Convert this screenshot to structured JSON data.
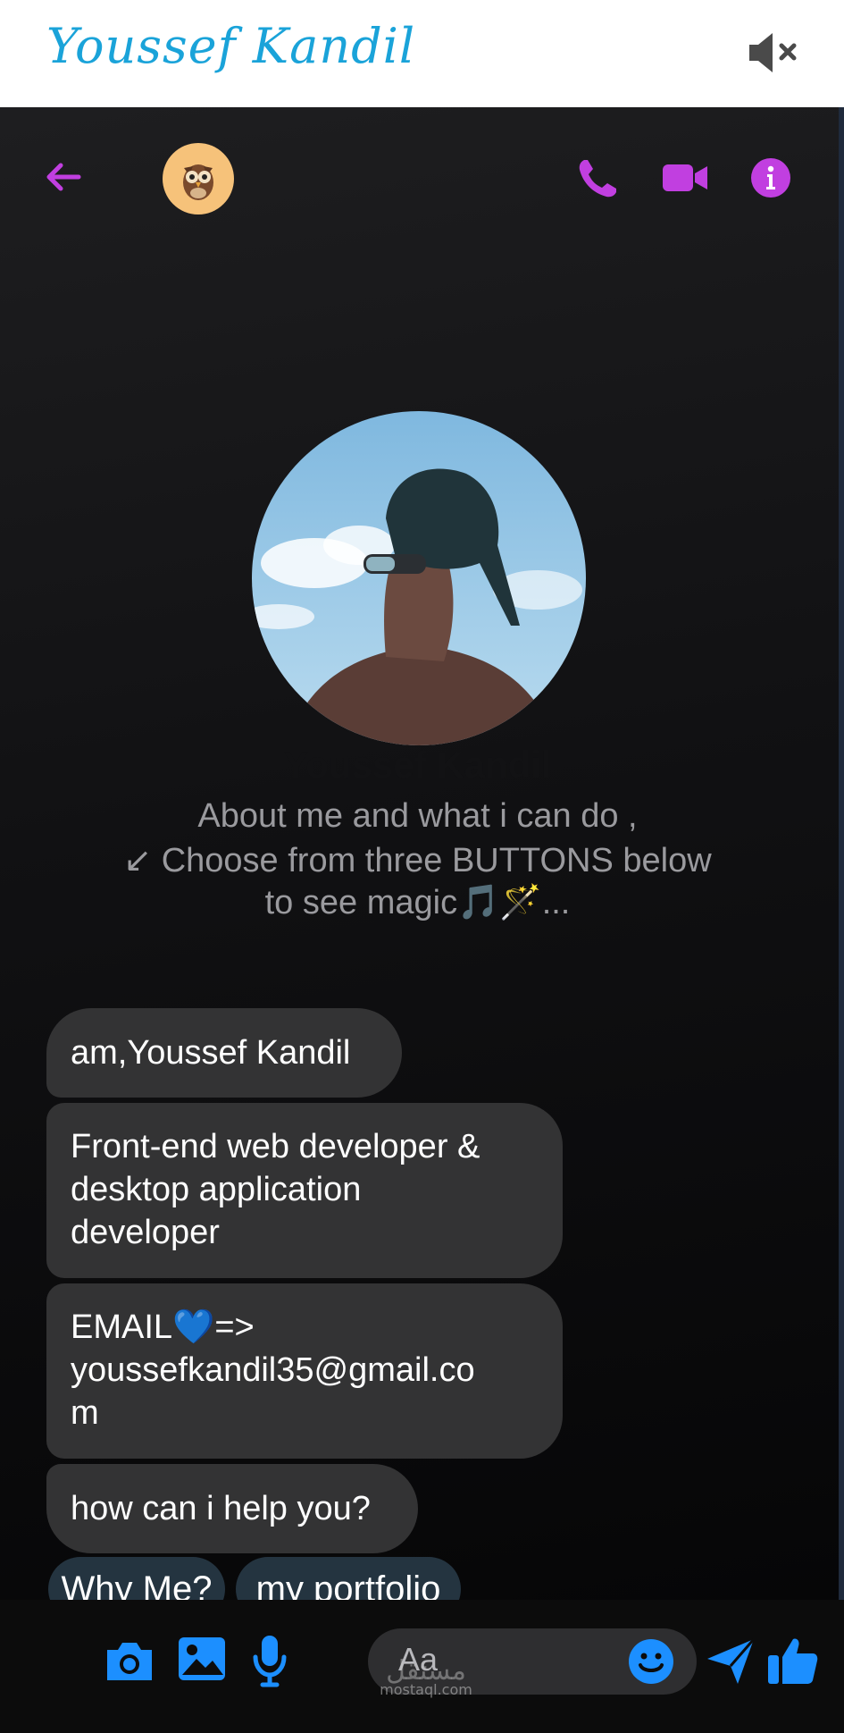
{
  "header": {
    "brand": "Youssef Kandil",
    "mute_icon": "speaker-muted-icon"
  },
  "toolbar": {
    "back_icon": "arrow-left-icon",
    "avatar": "owl-avatar",
    "call_icon": "phone-icon",
    "video_icon": "video-camera-icon",
    "info_icon": "info-icon"
  },
  "profile": {
    "name": "Youssef Kandil",
    "intro_lines": [
      "About me and what i can do ,",
      "↙ Choose from three BUTTONS below",
      "to see magic🎵🪄..."
    ]
  },
  "messages": [
    {
      "lines": [
        "am,Youssef Kandil"
      ]
    },
    {
      "lines": [
        "Front-end web developer &",
        "desktop application",
        "developer"
      ]
    },
    {
      "lines": [
        "EMAIL💙=>",
        "youssefkandil35@gmail.co",
        "m"
      ]
    },
    {
      "lines": [
        "how can i help you?"
      ]
    }
  ],
  "quick_replies": [
    "Why Me?",
    "my portfolio"
  ],
  "composer": {
    "placeholder": "Aa",
    "watermark_ar": "مستقل",
    "watermark_en": "mostaql.com"
  },
  "colors": {
    "accent_purple": "#c13fe0",
    "accent_blue": "#1c8fff",
    "brand_blue": "#1aa3d9",
    "bubble": "#333334"
  }
}
